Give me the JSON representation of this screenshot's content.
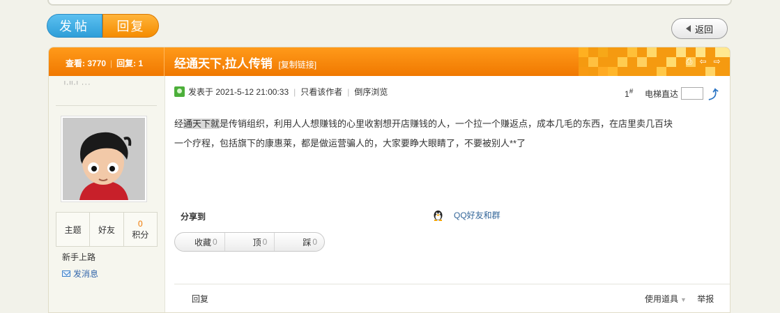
{
  "toolbar": {
    "post_label": "发帖",
    "reply_label": "回复",
    "back_label": "返回"
  },
  "thread": {
    "views_label": "查看:",
    "views": "3770",
    "replies_label": "回复:",
    "replies": "1",
    "title": "经通天下,拉人传销",
    "copy_link": "[复制链接]"
  },
  "author": {
    "name_partial": "ᴵ·ᴵᴵ·ᴵ ···",
    "stats": [
      {
        "label": "主题",
        "value": ""
      },
      {
        "label": "好友",
        "value": ""
      },
      {
        "label": "积分",
        "value": "0"
      }
    ],
    "rank": "新手上路",
    "send_message": "发消息"
  },
  "post": {
    "posted_prefix": "发表于",
    "posted_time": "2021-5-12 21:00:33",
    "only_author": "只看该作者",
    "reverse_order": "倒序浏览",
    "floor_number": "1",
    "floor_mark": "#",
    "elevator_label": "电梯直达",
    "content_hl_prefix": "经",
    "content_hl": "通天下就",
    "content_rest_line1": "是传销组织，利用人人想赚钱的心里收割想开店赚钱的人，一个拉一个赚返点，成本几毛的东西，在店里卖几百块",
    "content_line2": "一个疗程，包括旗下的康惠莱，都是做运营骗人的，大家要睁大眼睛了，不要被别人**了",
    "share_label": "分享到",
    "qq_share": "QQ好友和群",
    "votes": [
      {
        "label": "收藏",
        "count": "0"
      },
      {
        "label": "顶",
        "count": "0"
      },
      {
        "label": "踩",
        "count": "0"
      }
    ],
    "reply_link": "回复",
    "use_tool": "使用道具",
    "report": "举报"
  },
  "colors": {
    "accent_orange": "#f07800",
    "accent_blue": "#2e9ed8",
    "link_blue": "#336699"
  }
}
